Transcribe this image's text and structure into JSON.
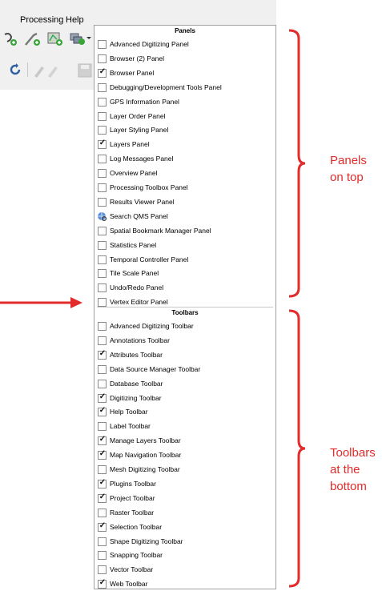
{
  "menubar": {
    "processing": "Processing",
    "help": "Help"
  },
  "sections": {
    "panels_header": "Panels",
    "toolbars_header": "Toolbars"
  },
  "panels": [
    {
      "label": "Advanced Digitizing Panel",
      "checked": false
    },
    {
      "label": "Browser (2) Panel",
      "checked": false
    },
    {
      "label": "Browser Panel",
      "checked": true
    },
    {
      "label": "Debugging/Development Tools Panel",
      "checked": false
    },
    {
      "label": "GPS Information Panel",
      "checked": false
    },
    {
      "label": "Layer Order Panel",
      "checked": false
    },
    {
      "label": "Layer Styling Panel",
      "checked": false
    },
    {
      "label": "Layers Panel",
      "checked": true
    },
    {
      "label": "Log Messages Panel",
      "checked": false
    },
    {
      "label": "Overview Panel",
      "checked": false
    },
    {
      "label": "Processing Toolbox Panel",
      "checked": false
    },
    {
      "label": "Results Viewer Panel",
      "checked": false
    },
    {
      "label": "Search QMS Panel",
      "checked": false,
      "icon": "qms-globe-icon"
    },
    {
      "label": "Spatial Bookmark Manager Panel",
      "checked": false
    },
    {
      "label": "Statistics Panel",
      "checked": false
    },
    {
      "label": "Temporal Controller Panel",
      "checked": false
    },
    {
      "label": "Tile Scale Panel",
      "checked": false
    },
    {
      "label": "Undo/Redo Panel",
      "checked": false
    },
    {
      "label": "Vertex Editor Panel",
      "checked": false
    }
  ],
  "toolbars": [
    {
      "label": "Advanced Digitizing Toolbar",
      "checked": false
    },
    {
      "label": "Annotations Toolbar",
      "checked": false
    },
    {
      "label": "Attributes Toolbar",
      "checked": true
    },
    {
      "label": "Data Source Manager Toolbar",
      "checked": false
    },
    {
      "label": "Database Toolbar",
      "checked": false
    },
    {
      "label": "Digitizing Toolbar",
      "checked": true
    },
    {
      "label": "Help Toolbar",
      "checked": true
    },
    {
      "label": "Label Toolbar",
      "checked": false
    },
    {
      "label": "Manage Layers Toolbar",
      "checked": true
    },
    {
      "label": "Map Navigation Toolbar",
      "checked": true
    },
    {
      "label": "Mesh Digitizing Toolbar",
      "checked": false
    },
    {
      "label": "Plugins Toolbar",
      "checked": true
    },
    {
      "label": "Project Toolbar",
      "checked": true
    },
    {
      "label": "Raster Toolbar",
      "checked": false
    },
    {
      "label": "Selection Toolbar",
      "checked": true
    },
    {
      "label": "Shape Digitizing Toolbar",
      "checked": false
    },
    {
      "label": "Snapping Toolbar",
      "checked": false
    },
    {
      "label": "Vector Toolbar",
      "checked": false
    },
    {
      "label": "Web Toolbar",
      "checked": true
    }
  ],
  "annotations": {
    "panels_line1": "Panels",
    "panels_line2": "on top",
    "toolbars_line1": "Toolbars",
    "toolbars_line2": "at the",
    "toolbars_line3": "bottom"
  },
  "colors": {
    "annotation": "#e32b2b",
    "menu_border": "#a0a0a0",
    "menubar_bg": "#f0f0f0"
  }
}
